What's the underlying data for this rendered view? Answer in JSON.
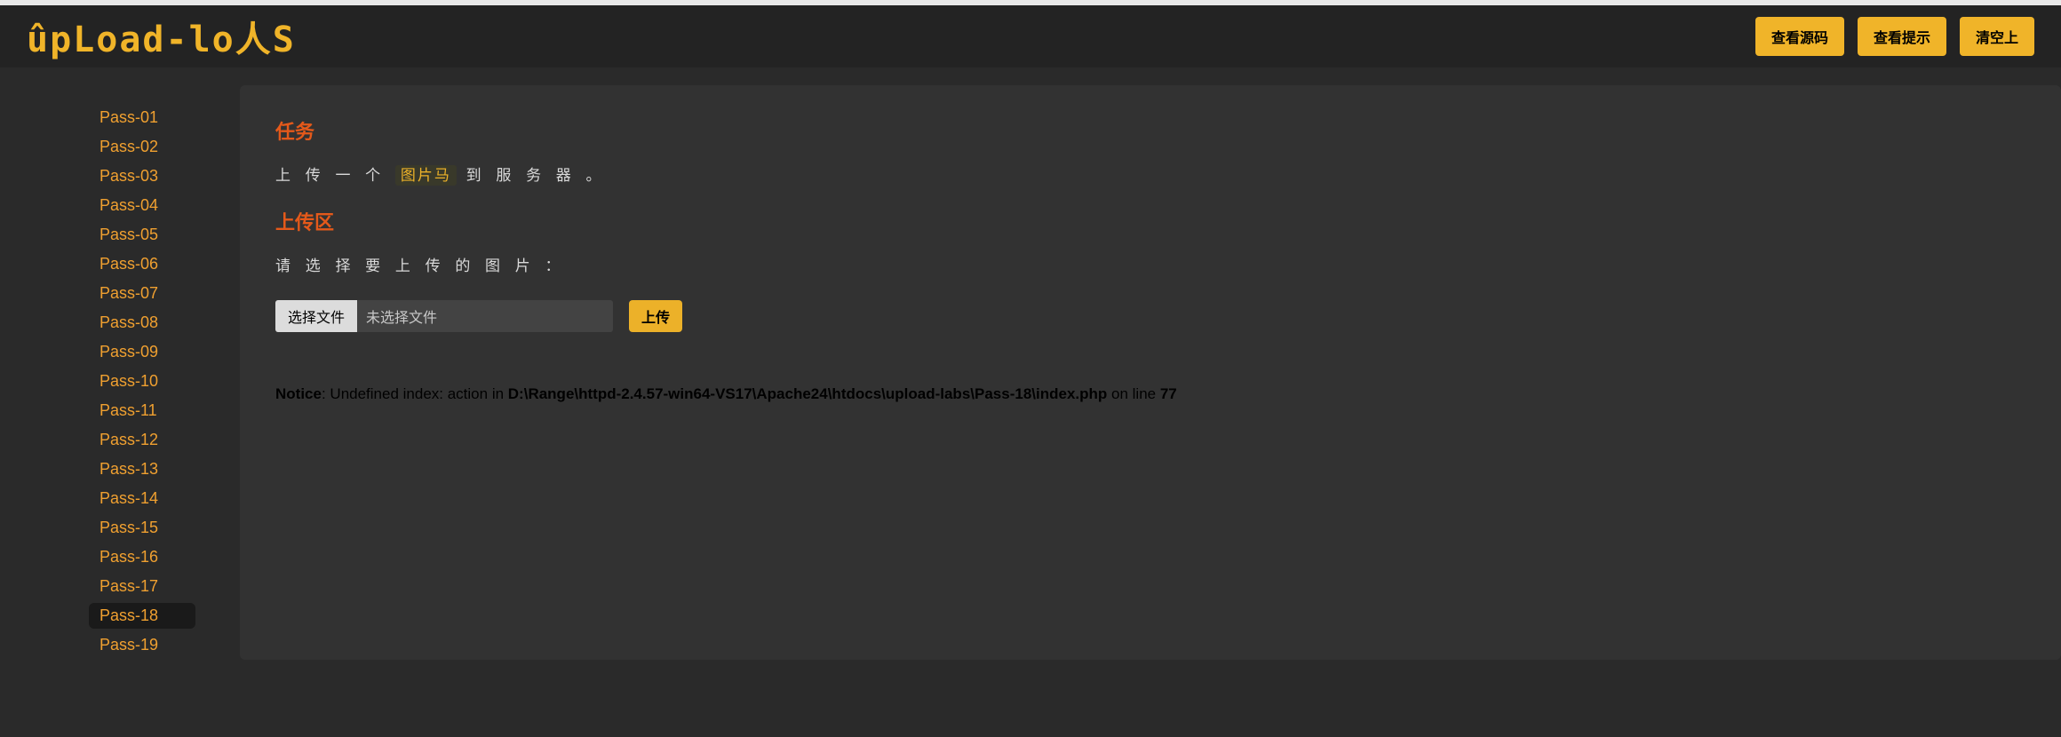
{
  "logo": "ûpLoad-lo人S",
  "header_buttons": {
    "view_source": "查看源码",
    "view_hint": "查看提示",
    "clear": "清空上"
  },
  "sidebar": {
    "items": [
      {
        "label": "Pass-01"
      },
      {
        "label": "Pass-02"
      },
      {
        "label": "Pass-03"
      },
      {
        "label": "Pass-04"
      },
      {
        "label": "Pass-05"
      },
      {
        "label": "Pass-06"
      },
      {
        "label": "Pass-07"
      },
      {
        "label": "Pass-08"
      },
      {
        "label": "Pass-09"
      },
      {
        "label": "Pass-10"
      },
      {
        "label": "Pass-11"
      },
      {
        "label": "Pass-12"
      },
      {
        "label": "Pass-13"
      },
      {
        "label": "Pass-14"
      },
      {
        "label": "Pass-15"
      },
      {
        "label": "Pass-16"
      },
      {
        "label": "Pass-17"
      },
      {
        "label": "Pass-18"
      },
      {
        "label": "Pass-19"
      }
    ],
    "active_index": 17
  },
  "content": {
    "task_title": "任务",
    "task_prefix": "上 传 一 个",
    "task_highlight": "图片马",
    "task_suffix": "到 服 务 器 。",
    "upload_title": "上传区",
    "upload_prompt": "请 选 择 要 上 传 的 图 片 ：",
    "file_button": "选择文件",
    "file_status": "未选择文件",
    "submit_label": "上传",
    "notice": {
      "label": "Notice",
      "message": ": Undefined index: action in ",
      "path": "D:\\Range\\httpd-2.4.57-win64-VS17\\Apache24\\htdocs\\upload-labs\\Pass-18\\index.php",
      "on_line": " on line ",
      "line": "77"
    }
  }
}
